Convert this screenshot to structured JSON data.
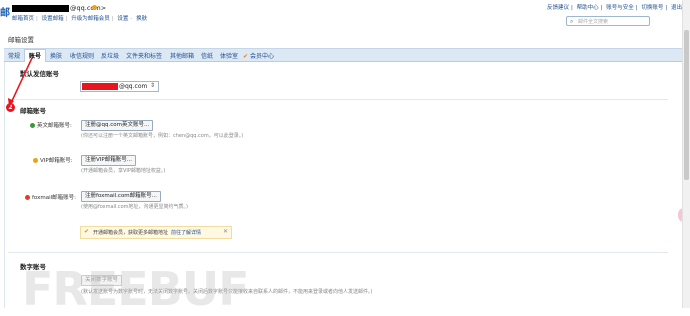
{
  "header": {
    "logo_text": "邮",
    "account_suffix": "@qq.com>",
    "top_links": [
      "邮箱首页",
      "设置邮箱",
      "升级为邮箱会员",
      "设置",
      "换肤"
    ],
    "right_links": [
      "反馈建议",
      "帮助中心",
      "账号与安全",
      "切换账号",
      "退出"
    ],
    "search_placeholder": "邮件全文搜索"
  },
  "page": {
    "title": "邮箱设置"
  },
  "tabs": [
    {
      "label": "常规"
    },
    {
      "label": "账号",
      "active": true
    },
    {
      "label": "换肤"
    },
    {
      "label": "收信规则"
    },
    {
      "label": "反垃圾"
    },
    {
      "label": "文件夹和标签"
    },
    {
      "label": "其他邮箱"
    },
    {
      "label": "信纸"
    },
    {
      "label": "体验室"
    },
    {
      "label": "会员中心"
    }
  ],
  "default_account": {
    "title": "默认发信账号",
    "selected_value": "@qq.com"
  },
  "annotation": {
    "badge": "2"
  },
  "alias": {
    "title": "邮箱账号",
    "rows": [
      {
        "label": "英文邮箱账号:",
        "button": "注册@qq.com英文账号...",
        "hint": "(你还可以注册一个英文邮箱账号，例如：chen@qq.com，可以此登录。)"
      },
      {
        "label": "VIP邮箱账号:",
        "button": "注册VIP邮箱账号...",
        "hint": "(开通邮箱会员，享VIP邮箱地址权益。)"
      },
      {
        "label": "foxmail邮箱账号:",
        "button": "注册foxmail.com邮箱账号...",
        "hint": "(使用@foxmail.com地址，沟通更显简约气质。)"
      }
    ]
  },
  "promo": {
    "text": "开通邮箱会员，获取更多邮箱地址",
    "link": "前往了解详情",
    "close": "✕"
  },
  "number_account": {
    "title": "数字账号",
    "button": "关闭数字账号",
    "hint": "(默认发送账号为数字账号时，无法关闭数字账号。关闭后数字账号只能接收来自联系人的邮件，不能用来登录或者向他人发送邮件。)"
  },
  "watermark": "FREEBUF",
  "colors": {
    "tab_bg": "#dce8f4",
    "link": "#1d4f91",
    "annotation_red": "#e8141e",
    "promo_bg": "#fff9e3"
  }
}
